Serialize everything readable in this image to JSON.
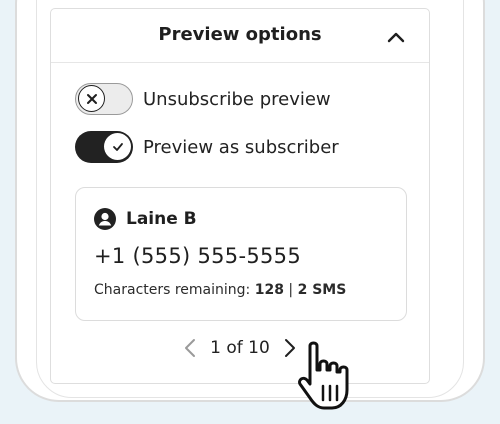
{
  "preview_options": {
    "title": "Preview options",
    "toggles": [
      {
        "label": "Unsubscribe preview",
        "state": "off"
      },
      {
        "label": "Preview as subscriber",
        "state": "on"
      }
    ]
  },
  "subscriber": {
    "name": "Laine B",
    "phone": "+1 (555) 555-5555",
    "chars_label": "Characters remaining:",
    "chars_count": "128",
    "separator": "|",
    "sms_count": "2 SMS"
  },
  "pager": {
    "text": "1 of 10"
  },
  "icons": {
    "collapse": "chevron-up-icon",
    "toggle_off": "x-icon",
    "toggle_on": "check-icon",
    "avatar": "person-circle-icon",
    "prev": "chevron-left-icon",
    "next": "chevron-right-icon",
    "cursor": "hand-pointer-icon"
  },
  "colors": {
    "background": "#eaf3f8",
    "toggle_on": "#222222",
    "toggle_off": "#ececec",
    "text": "#1f1f1f"
  }
}
